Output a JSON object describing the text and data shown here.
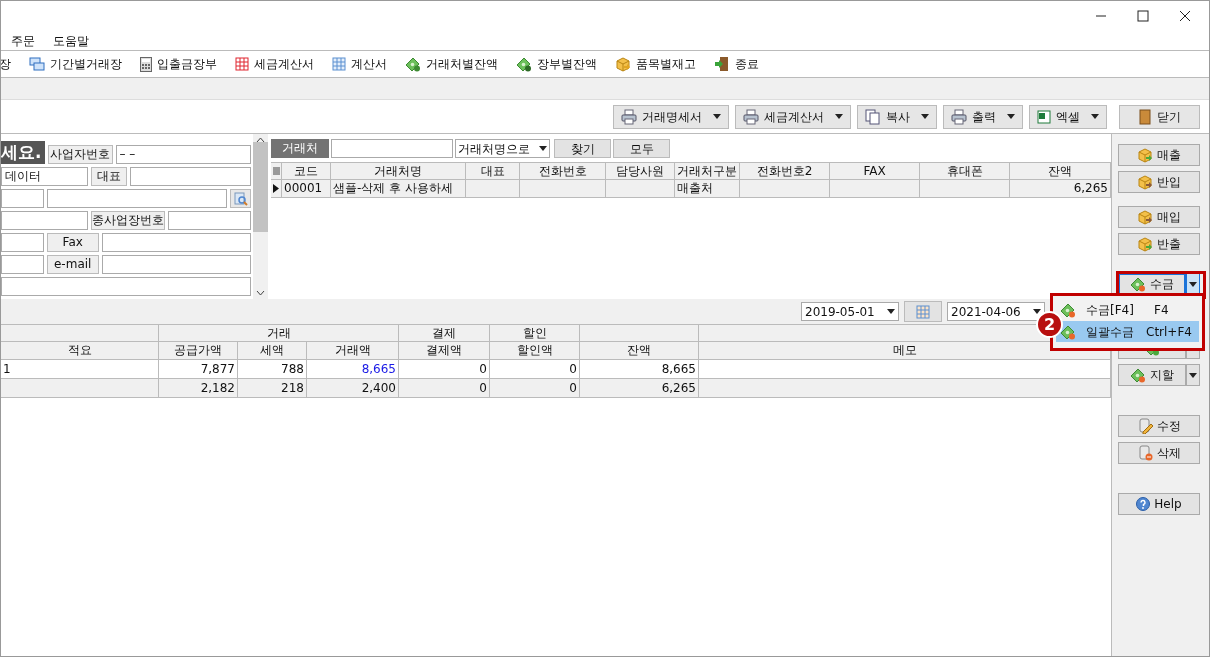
{
  "menu_bar": [
    "주문",
    "도움말"
  ],
  "toolbar": [
    "장",
    "기간별거래장",
    "입출금장부",
    "세금계산서",
    "계산서",
    "거래처별잔액",
    "장부별잔액",
    "품목별재고",
    "종료"
  ],
  "action_buttons": [
    {
      "label": "거래명세서",
      "dropdown": true
    },
    {
      "label": "세금계산서",
      "dropdown": true
    },
    {
      "label": "복사",
      "dropdown": true
    },
    {
      "label": "출력",
      "dropdown": true
    },
    {
      "label": "엑셀",
      "dropdown": true
    },
    {
      "label": "닫기",
      "dropdown": false
    }
  ],
  "customer_form": [
    [
      {
        "kind": "heading",
        "text": "세요."
      },
      {
        "kind": "label",
        "text": "사업자번호"
      },
      {
        "kind": "field",
        "value": "–   –"
      }
    ],
    [
      {
        "kind": "field",
        "value": "데이터"
      },
      {
        "kind": "label",
        "text": "대표"
      },
      {
        "kind": "field"
      }
    ],
    [
      {
        "kind": "field"
      },
      {
        "kind": "field"
      },
      {
        "kind": "lookup"
      }
    ],
    [
      {
        "kind": "field"
      },
      {
        "kind": "label",
        "text": "종사업장번호"
      },
      {
        "kind": "field"
      }
    ],
    [
      {
        "kind": "field"
      },
      {
        "kind": "label",
        "text": "Fax"
      },
      {
        "kind": "field"
      }
    ],
    [
      {
        "kind": "field"
      },
      {
        "kind": "label",
        "text": "e-mail"
      },
      {
        "kind": "field"
      }
    ],
    [
      {
        "kind": "field"
      }
    ]
  ],
  "customer_search": {
    "label": "거래처",
    "search_by": "거래처명으로",
    "buttons": [
      "찾기",
      "모두"
    ]
  },
  "customer_grid": {
    "columns": [
      "코드",
      "거래처명",
      "대표",
      "전화번호",
      "담당사원",
      "거래처구분",
      "전화번호2",
      "FAX",
      "휴대폰",
      "잔액"
    ],
    "rows": [
      {
        "selected": true,
        "cells": [
          "00001",
          "샘플-삭제 후 사용하세",
          null,
          null,
          null,
          "매출처",
          null,
          null,
          null,
          "6,265"
        ]
      }
    ]
  },
  "date_range": {
    "from": "2019-05-01",
    "to": "2021-04-06"
  },
  "ledger": {
    "groups": [
      "거래",
      "결제",
      "할인"
    ],
    "columns": [
      "적요",
      "공급가액",
      "세액",
      "거래액",
      "결제액",
      "할인액",
      "잔액",
      "메모"
    ],
    "rows": [
      {
        "kind": "entry",
        "cells": [
          "1",
          "7,877",
          "788",
          "8,665",
          "0",
          "0",
          "8,665",
          null
        ]
      },
      {
        "kind": "total",
        "cells": [
          null,
          "2,182",
          "218",
          "2,400",
          "0",
          "0",
          "6,265",
          null
        ]
      }
    ]
  },
  "sidebar": [
    [
      {
        "label": "매출",
        "split": false,
        "focused": false
      },
      {
        "label": "반입",
        "split": false,
        "focused": false
      }
    ],
    [
      {
        "label": "매입",
        "split": false,
        "focused": false
      },
      {
        "label": "반출",
        "split": false,
        "focused": false
      }
    ],
    [
      {
        "label": "수금",
        "split": true,
        "focused": true
      }
    ],
    [
      {
        "split": true,
        "focused": false
      },
      {
        "label": "지할",
        "split": true,
        "focused": false
      }
    ],
    [
      {
        "label": "수정",
        "split": false,
        "focused": false
      },
      {
        "label": "삭제",
        "split": false,
        "focused": false
      }
    ],
    [
      {
        "label": "Help",
        "split": false,
        "focused": false
      }
    ]
  ],
  "dropdown_menu": {
    "items": [
      {
        "label": "수금[F4]",
        "shortcut": "F4",
        "selected": false
      },
      {
        "label": "일괄수금",
        "shortcut": "Ctrl+F4",
        "selected": true
      }
    ]
  },
  "annotation": {
    "badge": "2"
  }
}
